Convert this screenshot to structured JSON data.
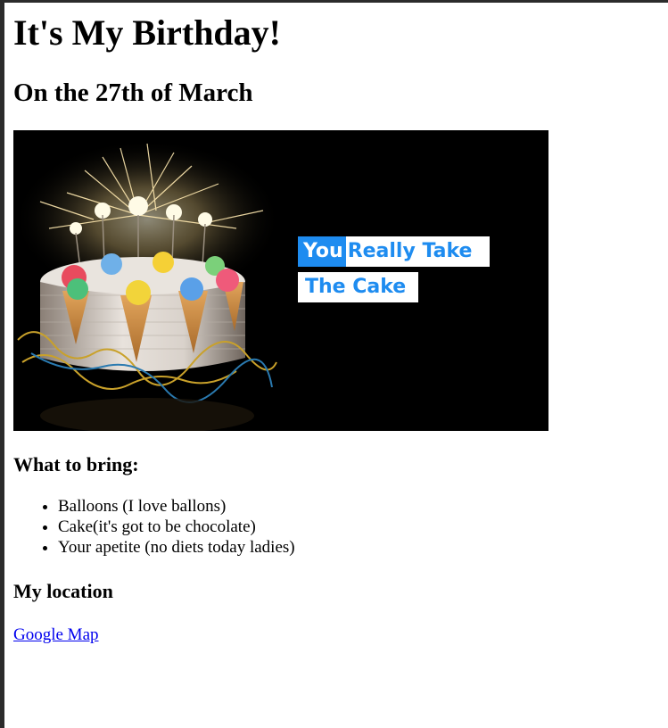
{
  "page": {
    "title": "It's My Birthday!",
    "subtitle": "On the 27th of March"
  },
  "hero": {
    "tagline_you": "You",
    "tagline_rest": "Really Take",
    "tagline_line2": "The Cake"
  },
  "bring": {
    "heading": "What to bring:",
    "items": [
      "Balloons (I love ballons)",
      "Cake(it's got to be chocolate)",
      "Your apetite (no diets today ladies)"
    ]
  },
  "location": {
    "heading": "My location",
    "link_text": "Google Map"
  }
}
